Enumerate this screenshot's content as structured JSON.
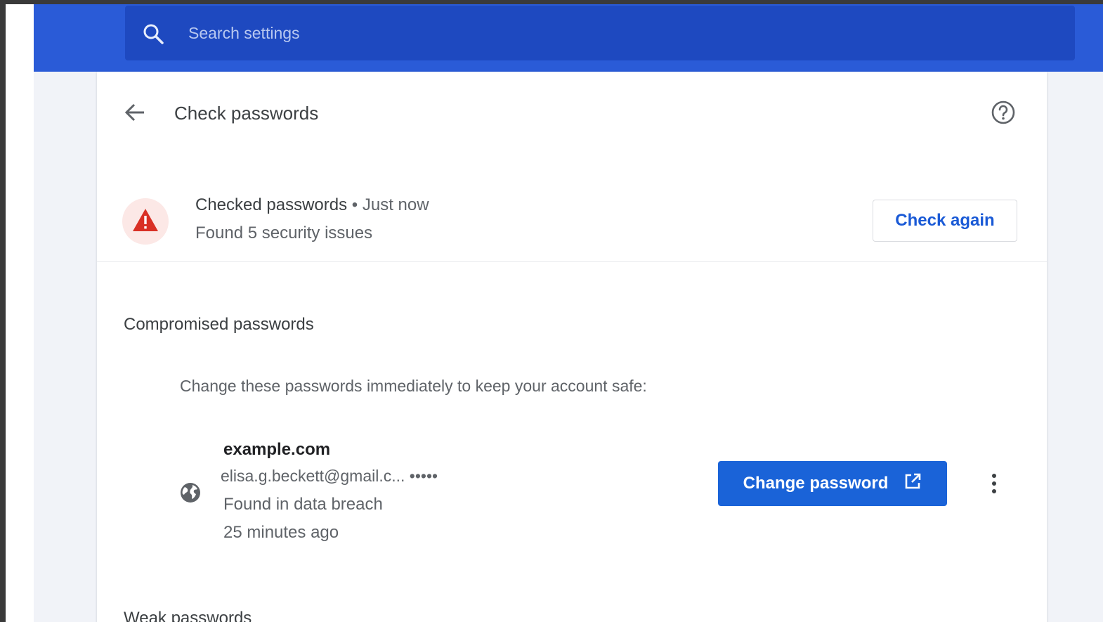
{
  "search": {
    "placeholder": "Search settings"
  },
  "header": {
    "title": "Check passwords"
  },
  "status": {
    "checked_label": "Checked passwords",
    "separator": "•",
    "checked_time": "Just now",
    "issues_text": "Found 5 security issues",
    "check_again_label": "Check again"
  },
  "compromised": {
    "title": "Compromised passwords",
    "description": "Change these passwords immediately to keep your account safe:",
    "entries": [
      {
        "site": "example.com",
        "username": "elisa.g.beckett@gmail.c... •••••",
        "status": "Found in data breach",
        "time": "25 minutes ago",
        "action_label": "Change password"
      }
    ]
  },
  "weak": {
    "title": "Weak passwords"
  },
  "colors": {
    "header_blue": "#2a5bd7",
    "search_box_blue": "#1e49c0",
    "primary_button": "#1a63d8",
    "warning_red": "#d93025",
    "warning_bg": "#fce8e6"
  },
  "icons": {
    "search": "search-icon",
    "back": "arrow-back-icon",
    "help": "help-circle-icon",
    "warning": "warning-triangle-icon",
    "site": "globe-icon",
    "external": "open-in-new-icon",
    "more": "more-vert-icon"
  }
}
